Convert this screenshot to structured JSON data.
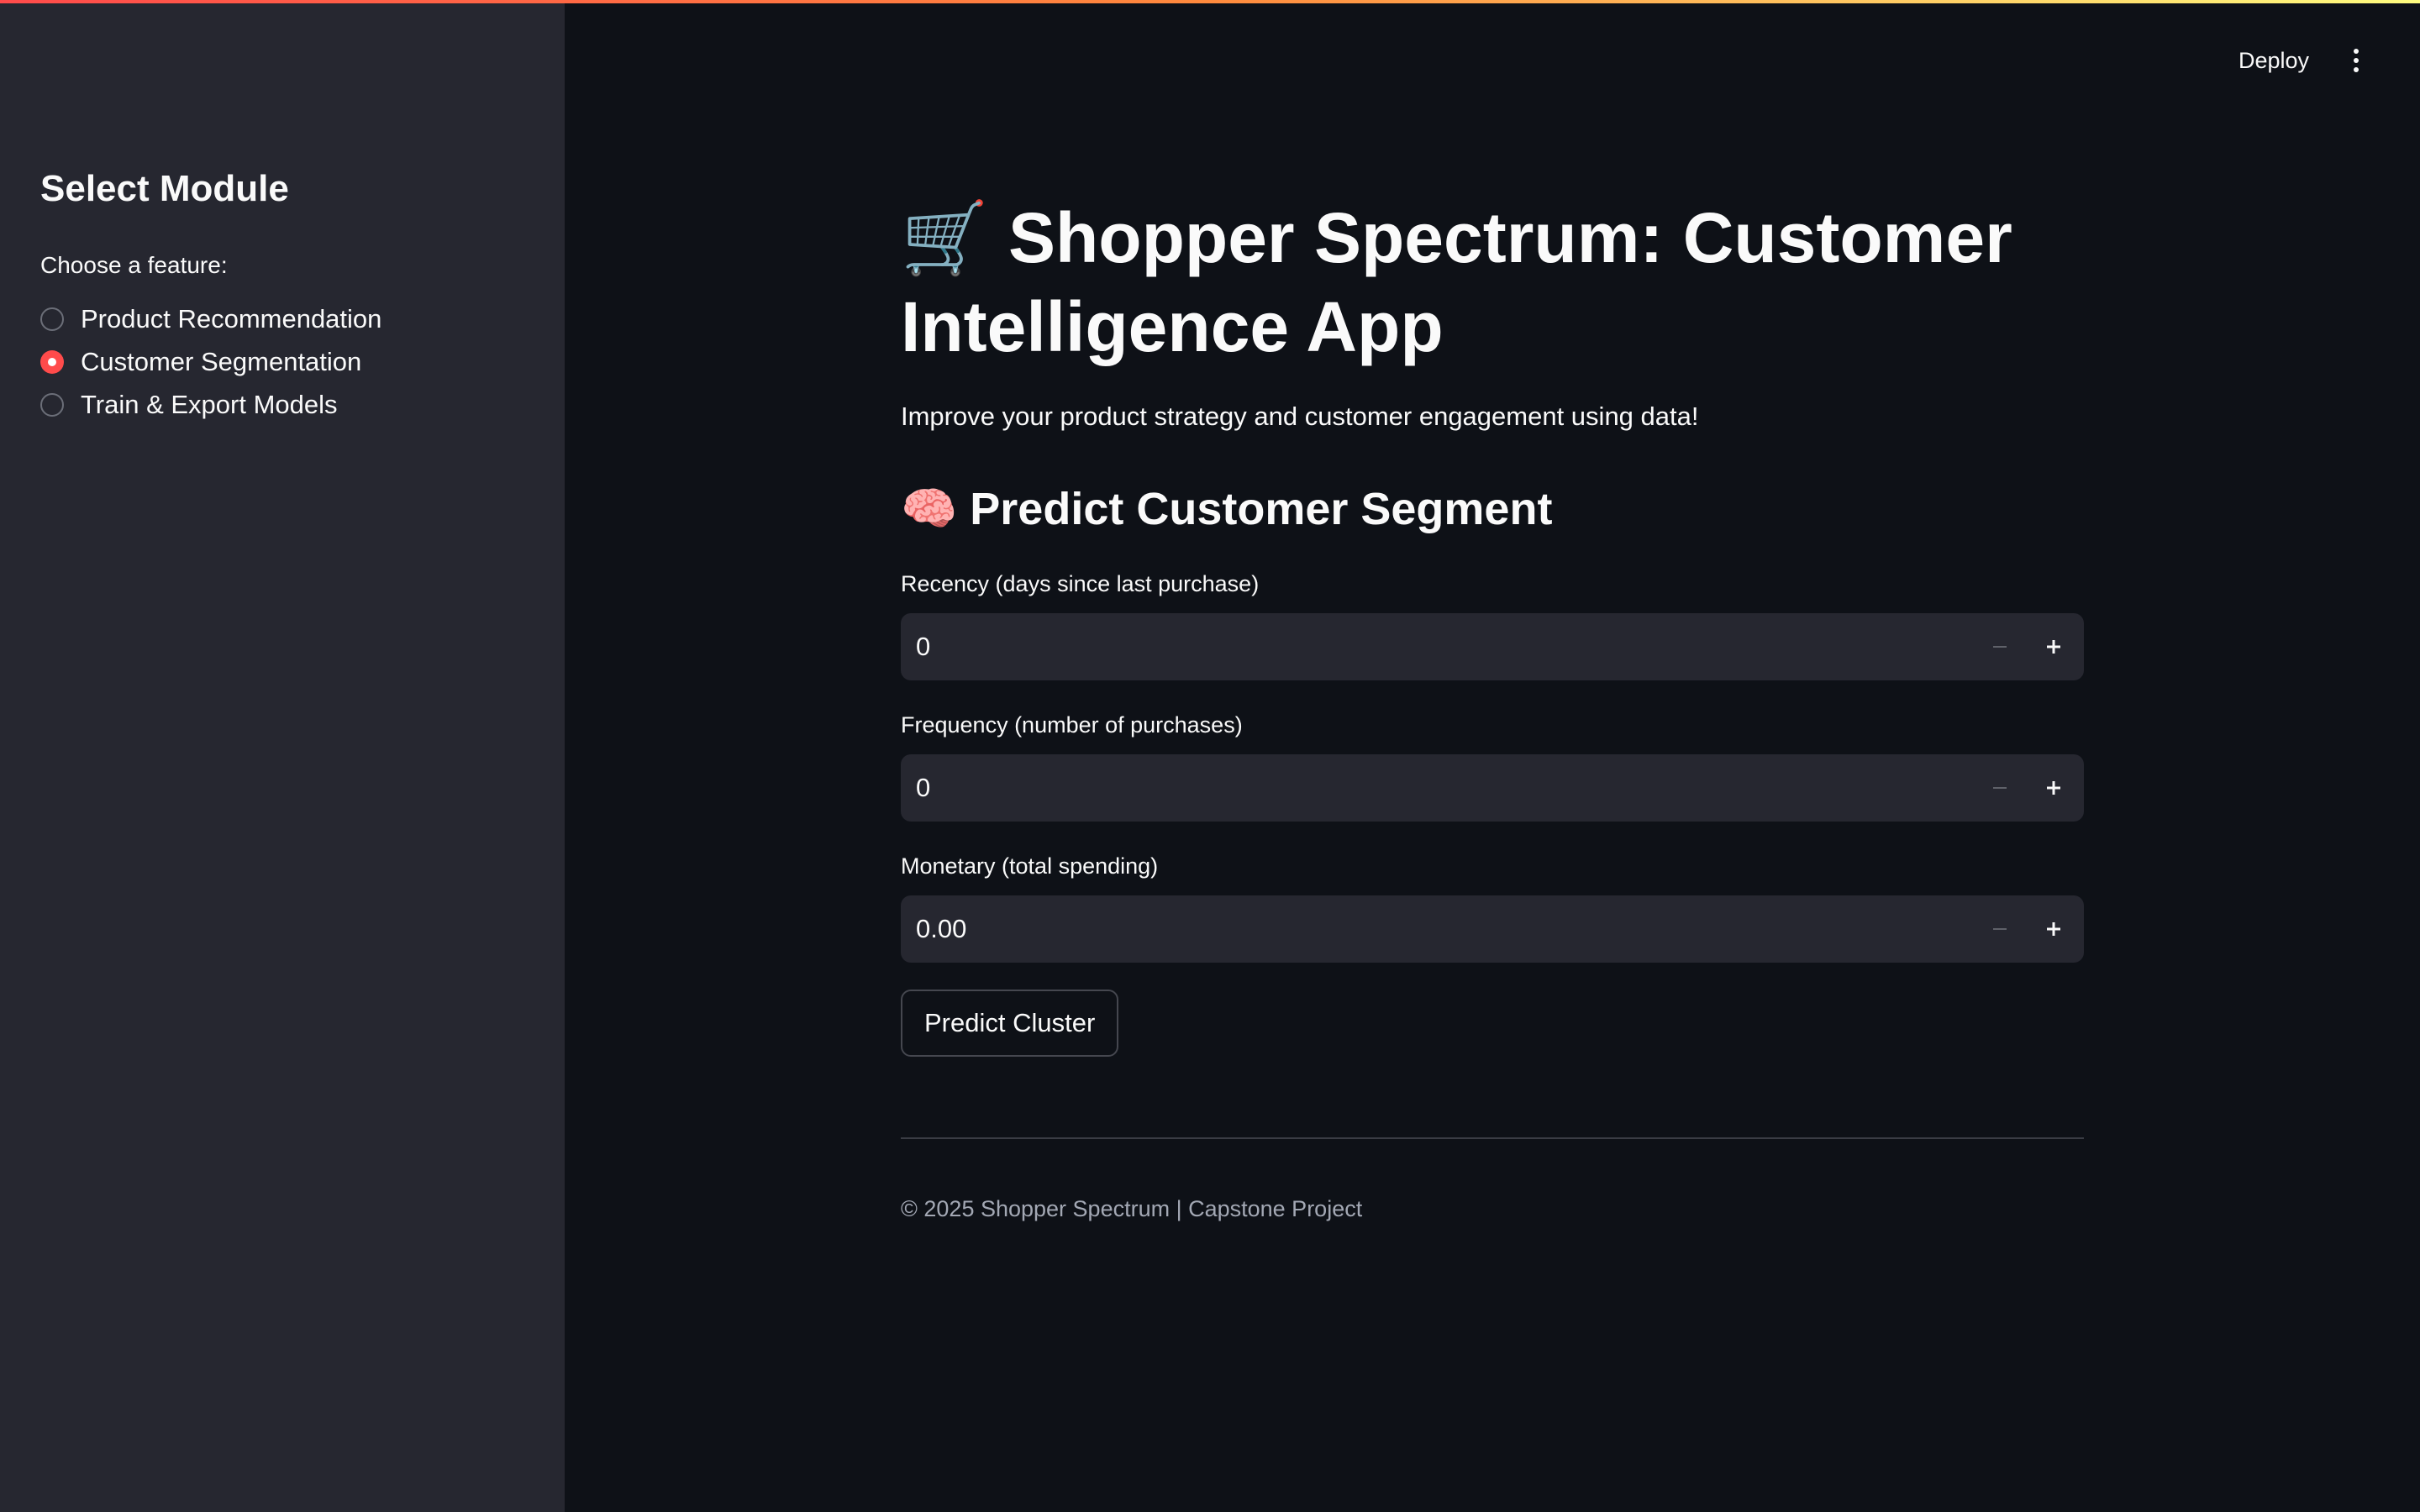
{
  "header": {
    "deploy_label": "Deploy",
    "menu_icon": "more-vertical-icon"
  },
  "sidebar": {
    "title": "Select Module",
    "radio_label": "Choose a feature:",
    "options": [
      {
        "label": "Product Recommendation",
        "selected": false
      },
      {
        "label": "Customer Segmentation",
        "selected": true
      },
      {
        "label": "Train & Export Models",
        "selected": false
      }
    ]
  },
  "main": {
    "title_emoji": "🛒",
    "title": "Shopper Spectrum: Customer Intelligence App",
    "subtitle": "Improve your product strategy and customer engagement using data!",
    "section_emoji": "🧠",
    "section_title": "Predict Customer Segment",
    "fields": [
      {
        "label": "Recency (days since last purchase)",
        "value": "0"
      },
      {
        "label": "Frequency (number of purchases)",
        "value": "0"
      },
      {
        "label": "Monetary (total spending)",
        "value": "0.00"
      }
    ],
    "predict_button": "Predict Cluster",
    "footer": "© 2025 Shopper Spectrum | Capstone Project"
  },
  "colors": {
    "background": "#0e1117",
    "sidebar": "#262730",
    "accent": "#ff4b4b",
    "text": "#fafafa",
    "muted_text": "#a3a8b4"
  }
}
